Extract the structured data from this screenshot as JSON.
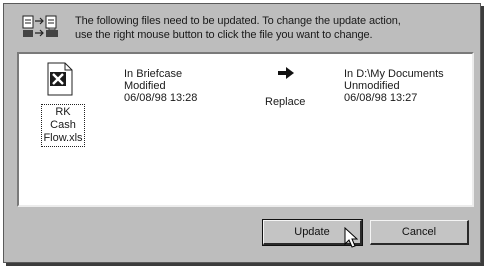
{
  "header": {
    "message_line1": "The following files need to be updated. To change the update action,",
    "message_line2": "use the right mouse button to click the file you want to change.",
    "icon": "briefcase-sync-icon"
  },
  "file": {
    "name_line1": "RK Cash",
    "name_line2": "Flow.xls",
    "icon": "excel-file-icon",
    "left": {
      "location": "In Briefcase",
      "status": "Modified",
      "date": "06/08/98 13:28"
    },
    "right": {
      "location": "In D:\\My Documents",
      "status": "Unmodified",
      "date": "06/08/98 13:27"
    },
    "action": "Replace",
    "action_icon": "arrow-right-icon"
  },
  "buttons": {
    "update": "Update",
    "cancel": "Cancel"
  }
}
